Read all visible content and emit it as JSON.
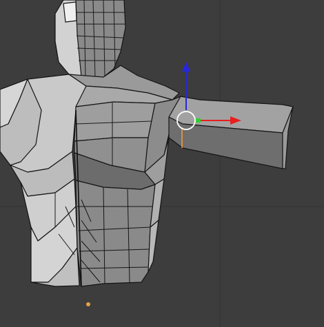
{
  "viewport": {
    "background": "#3d3d3d",
    "grid_color": "#353535",
    "mesh_face_light": "#c8c8c8",
    "mesh_face_mid": "#a5a5a5",
    "mesh_face_dark": "#7e7e7e",
    "mesh_edge": "#111111",
    "selected_edge": "#ff9a3c",
    "origin_dot": "#e8a04a"
  },
  "gizmo": {
    "x_axis_color": "#e81e1e",
    "y_axis_color": "#2fd12f",
    "z_axis_color": "#2626e0",
    "center_ring_color": "#ffffff",
    "icons": [
      "translate-x-arrow-icon",
      "translate-y-handle-icon",
      "translate-z-arrow-icon",
      "pivot-ring-icon"
    ]
  }
}
